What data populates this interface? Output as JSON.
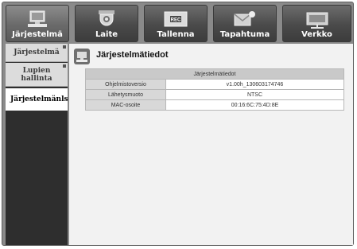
{
  "tabs": [
    {
      "label": "Järjestelmä",
      "icon": "system-icon",
      "active": true
    },
    {
      "label": "Laite",
      "icon": "camera-icon",
      "active": false
    },
    {
      "label": "Tallenna",
      "icon": "rec-icon",
      "active": false
    },
    {
      "label": "Tapahtuma",
      "icon": "event-icon",
      "active": false
    },
    {
      "label": "Verkko",
      "icon": "network-icon",
      "active": false
    }
  ],
  "menu": {
    "items": [
      {
        "label": "Järjestelmä"
      },
      {
        "label": "Lupien hallinta"
      },
      {
        "label": "Järjestelmänls"
      }
    ]
  },
  "main": {
    "title": "Järjestelmätiedot",
    "table_header": "Järjestelmätiedot",
    "rows": [
      {
        "label": "Ohjelmistoversio",
        "value": "v1.00h_130603174746"
      },
      {
        "label": "Lähetysmuoto",
        "value": "NTSC"
      },
      {
        "label": "MAC-osoite",
        "value": "00:16:6C:75:4D:8E"
      }
    ]
  }
}
